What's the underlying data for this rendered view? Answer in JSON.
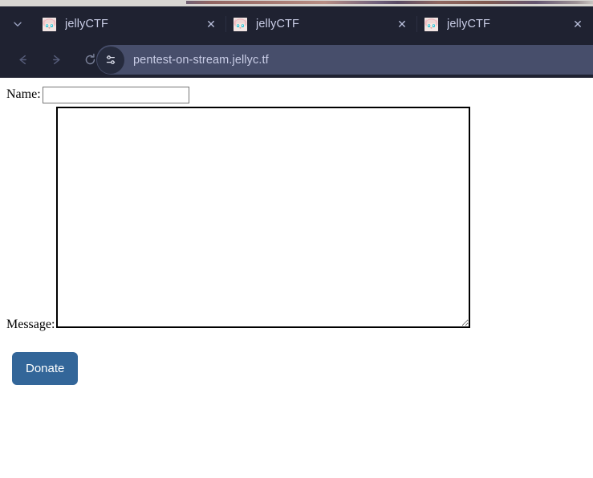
{
  "browser": {
    "tab_list_icon": "chevron-down-icon",
    "tabs": [
      {
        "title": "jellyCTF",
        "favicon": "jellyctf-anime-face-favicon",
        "close_label": "✕"
      },
      {
        "title": "jellyCTF",
        "favicon": "jellyctf-anime-face-favicon",
        "close_label": "✕"
      },
      {
        "title": "jellyCTF",
        "favicon": "jellyctf-anime-face-favicon",
        "close_label": "✕"
      }
    ],
    "toolbar": {
      "back_icon": "back-arrow-icon",
      "forward_icon": "forward-arrow-icon",
      "reload_icon": "reload-icon",
      "site_info_icon": "site-settings-sliders-icon",
      "url": "pentest-on-stream.jellyc.tf"
    },
    "colors": {
      "chrome_background": "#1f2231",
      "urlbar_background": "#474e6b",
      "tab_text": "#c9cde6"
    }
  },
  "page": {
    "form": {
      "name_label": "Name:",
      "name_value": "",
      "name_placeholder": "",
      "message_label": "Message:",
      "message_value": "",
      "message_placeholder": "",
      "submit_label": "Donate",
      "submit_color": "#336699"
    }
  }
}
